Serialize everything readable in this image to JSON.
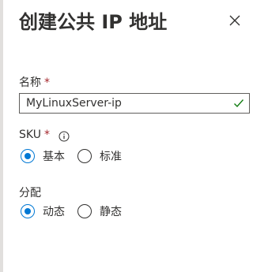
{
  "panel": {
    "title": "创建公共 IP 地址"
  },
  "name_field": {
    "label": "名称",
    "required_mark": "*",
    "value": "MyLinuxServer-ip"
  },
  "sku": {
    "label": "SKU",
    "required_mark": "*",
    "options": [
      {
        "label": "基本",
        "selected": true
      },
      {
        "label": "标准",
        "selected": false
      }
    ]
  },
  "assignment": {
    "label": "分配",
    "options": [
      {
        "label": "动态",
        "selected": true
      },
      {
        "label": "静态",
        "selected": false
      }
    ]
  },
  "colors": {
    "accent": "#0078d4",
    "required": "#a4262c",
    "valid": "#107c10"
  },
  "icons": [
    "close-icon",
    "info-icon",
    "check-icon"
  ]
}
